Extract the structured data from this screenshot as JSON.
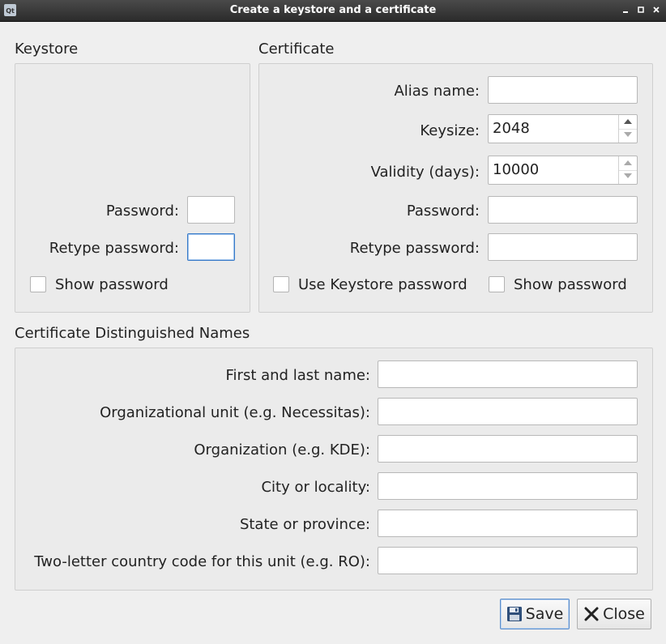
{
  "window": {
    "title": "Create a keystore and a certificate",
    "app_icon": "qt-logo-icon",
    "controls": [
      "minimize-icon",
      "maximize-icon",
      "close-icon"
    ]
  },
  "keystore": {
    "section_label": "Keystore",
    "password_label": "Password:",
    "password_value": "",
    "retype_label": "Retype password:",
    "retype_value": "",
    "show_password_label": "Show password",
    "show_password_checked": false
  },
  "certificate": {
    "section_label": "Certificate",
    "alias_label": "Alias name:",
    "alias_value": "",
    "keysize_label": "Keysize:",
    "keysize_value": "2048",
    "validity_label": "Validity (days):",
    "validity_value": "10000",
    "password_label": "Password:",
    "password_value": "",
    "retype_label": "Retype password:",
    "retype_value": "",
    "use_keystore_label": "Use Keystore password",
    "use_keystore_checked": false,
    "show_password_label": "Show password",
    "show_password_checked": false
  },
  "dn": {
    "section_label": "Certificate Distinguished Names",
    "fields": [
      {
        "label": "First and last name:",
        "value": ""
      },
      {
        "label": "Organizational unit (e.g. Necessitas):",
        "value": ""
      },
      {
        "label": "Organization (e.g. KDE):",
        "value": ""
      },
      {
        "label": "City or locality:",
        "value": ""
      },
      {
        "label": "State or province:",
        "value": ""
      },
      {
        "label": "Two-letter country code for this unit (e.g. RO):",
        "value": ""
      }
    ]
  },
  "buttons": {
    "save_label": "Save",
    "save_icon": "floppy-disk-icon",
    "close_label": "Close",
    "close_icon": "close-x-icon"
  },
  "colors": {
    "titlebar": "#2b2b2b",
    "focus": "#3a7bc8",
    "window_bg": "#efefef"
  }
}
